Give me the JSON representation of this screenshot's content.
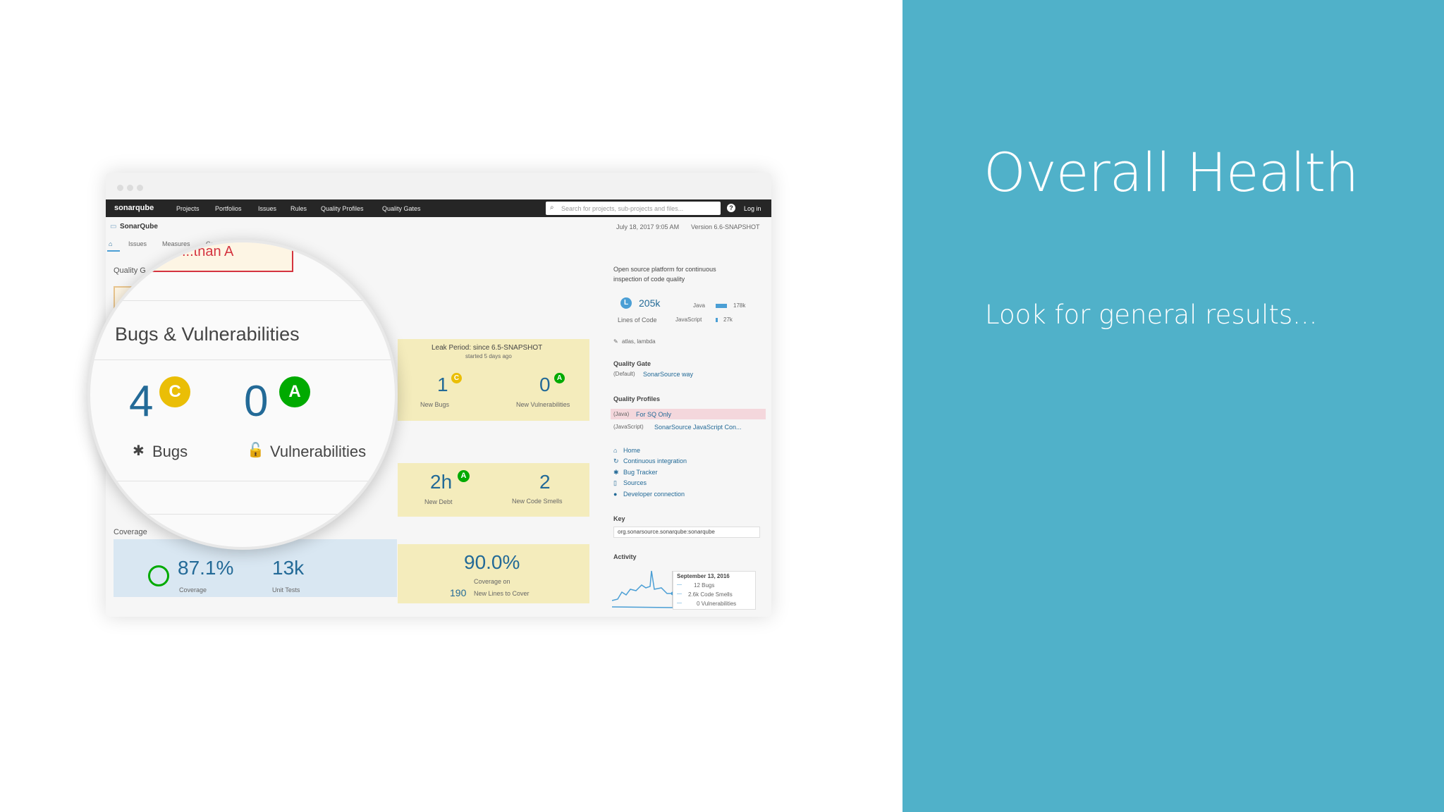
{
  "slide": {
    "title": "Overall Health",
    "subtitle": "Look for general results..."
  },
  "screenshot": {
    "navbar": {
      "logo": "sonarqube",
      "items": [
        "Projects",
        "Portfolios",
        "Issues",
        "Rules",
        "Quality Profiles",
        "Quality Gates"
      ],
      "search_placeholder": "Search for projects, sub-projects and files...",
      "login": "Log in"
    },
    "project": {
      "name": "SonarQube",
      "date": "July 18, 2017 9:05 AM",
      "version": "Version 6.6-SNAPSHOT",
      "tabs": [
        "Issues",
        "Measures",
        "Co"
      ]
    },
    "quality_gate_label": "Quality G",
    "leak_period": {
      "title": "Leak Period: since 6.5-SNAPSHOT",
      "subtitle": "started 5 days ago",
      "new_bugs": "1",
      "new_bugs_label": "New Bugs",
      "new_vulns": "0",
      "new_vulns_label": "New Vulnerabilities",
      "new_debt": "2h",
      "new_debt_label": "New Debt",
      "new_smells": "2",
      "new_smells_label": "New Code Smells"
    },
    "coverage": {
      "heading": "Coverage",
      "value": "87.1%",
      "label": "Coverage",
      "unit_tests": "13k",
      "unit_tests_label": "Unit Tests",
      "new_coverage": "90.0%",
      "new_coverage_label": "Coverage on",
      "new_lines": "190",
      "new_lines_label": "New Lines to Cover"
    },
    "sidebar": {
      "description": [
        "Open source platform for continuous",
        "inspection of code quality"
      ],
      "size_badge": "L",
      "loc": "205k",
      "loc_label": "Lines of Code",
      "lang_java": "Java",
      "lang_java_value": "178k",
      "lang_js": "JavaScript",
      "lang_js_value": "27k",
      "tags": "atlas, lambda",
      "quality_gate_heading": "Quality Gate",
      "quality_gate_prefix": "(Default)",
      "quality_gate_value": "SonarSource way",
      "quality_profiles_heading": "Quality Profiles",
      "profile1_lang": "(Java)",
      "profile1": "For SQ Only",
      "profile2_lang": "(JavaScript)",
      "profile2": "SonarSource JavaScript Con...",
      "links": [
        "Home",
        "Continuous integration",
        "Bug Tracker",
        "Sources",
        "Developer connection"
      ],
      "key_heading": "Key",
      "key_value": "org.sonarsource.sonarqube:sonarqube",
      "activity_heading": "Activity",
      "tooltip_date": "September 13, 2016",
      "tooltip_lines": [
        "12 Bugs",
        "2.6k Code Smells",
        "0 Vulnerabilities"
      ]
    },
    "magnifier": {
      "failed_text": "...than A",
      "heading": "Bugs & Vulnerabilities",
      "bugs": "4",
      "bugs_rating": "C",
      "bugs_label": "Bugs",
      "vulns": "0",
      "vulns_rating": "A",
      "vulns_label": "Vulnerabilities"
    },
    "colors": {
      "teal_panel": "#50b1c9",
      "rating_a": "#00aa00",
      "rating_c": "#eabe06",
      "link_blue": "#236a97"
    }
  }
}
